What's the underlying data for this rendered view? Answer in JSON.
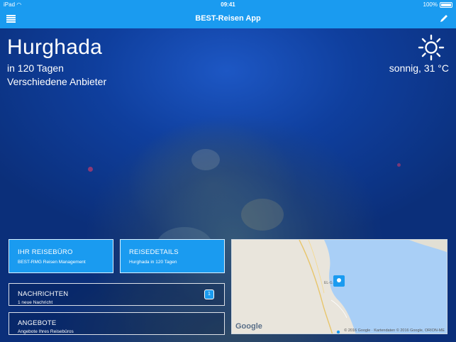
{
  "status_bar": {
    "device": "iPad",
    "time": "09:41",
    "battery": "100%"
  },
  "nav": {
    "title": "BEST-Reisen App",
    "menu_icon": "hamburger-menu-icon",
    "edit_icon": "pencil-icon"
  },
  "hero": {
    "destination": "Hurghada",
    "countdown": "in 120 Tagen",
    "providers": "Verschiedene Anbieter",
    "weather_icon": "sun-icon",
    "weather": "sonnig, 31 °C"
  },
  "tiles": {
    "agency": {
      "title": "IHR REISEBÜRO",
      "subtitle": "BEST-RMG Reisen Management"
    },
    "details": {
      "title": "REISEDETAILS",
      "subtitle": "Hurghada in 120 Tagen"
    },
    "messages": {
      "title": "NACHRICHTEN",
      "subtitle": "1 neue Nachricht",
      "badge": "1"
    },
    "offers": {
      "title": "ANGEBOTE",
      "subtitle": "Angebote Ihres Reisebüros"
    }
  },
  "map": {
    "logo": "Google",
    "town": "EL-G...",
    "attribution": "© 2016 Google · Kartendaten © 2016 Google, ORION-ME"
  },
  "colors": {
    "accent": "#1a9bf0"
  }
}
